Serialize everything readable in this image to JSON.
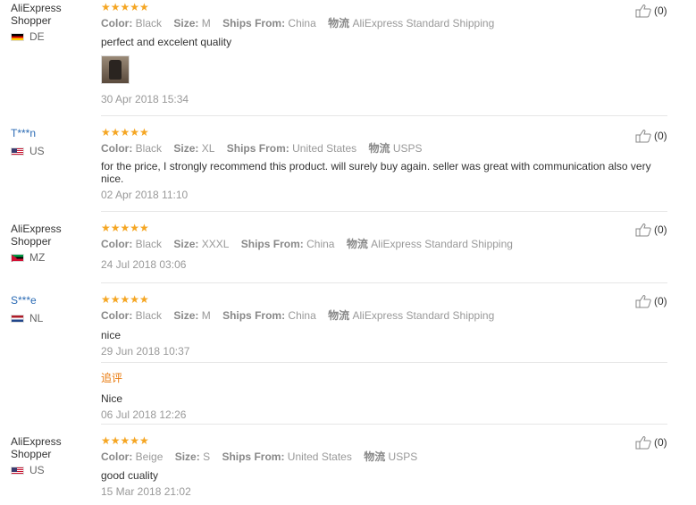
{
  "labels": {
    "color": "Color:",
    "size": "Size:",
    "ships": "Ships From:",
    "logistics": "物流"
  },
  "reviews": [
    {
      "user_line1": "AliExpress",
      "user_line2": "Shopper",
      "country": "DE",
      "stars": "★★★★★",
      "color": "Black",
      "size": "M",
      "ships": "China",
      "logistics": "AliExpress Standard Shipping",
      "text": "perfect and excelent quality",
      "date": "30 Apr 2018 15:34",
      "likes": "(0)"
    },
    {
      "user_line1": "T***n",
      "country": "US",
      "stars": "★★★★★",
      "color": "Black",
      "size": "XL",
      "ships": "United States",
      "logistics": "USPS",
      "text": "for the price, I strongly recommend this product. will surely buy again. seller was great with communication also very nice.",
      "date": "02 Apr 2018 11:10",
      "likes": "(0)"
    },
    {
      "user_line1": "AliExpress",
      "user_line2": "Shopper",
      "country": "MZ",
      "stars": "★★★★★",
      "color": "Black",
      "size": "XXXL",
      "ships": "China",
      "logistics": "AliExpress Standard Shipping",
      "date": "24 Jul 2018 03:06",
      "likes": "(0)"
    },
    {
      "user_line1": "S***e",
      "country": "NL",
      "stars": "★★★★★",
      "color": "Black",
      "size": "M",
      "ships": "China",
      "logistics": "AliExpress Standard Shipping",
      "text": "nice",
      "date": "29 Jun 2018 10:37",
      "likes": "(0)",
      "followup": {
        "label": "追评",
        "text": "Nice",
        "date": "06 Jul 2018 12:26"
      }
    },
    {
      "user_line1": "AliExpress",
      "user_line2": "Shopper",
      "country": "US",
      "stars": "★★★★★",
      "color": "Beige",
      "size": "S",
      "ships": "United States",
      "logistics": "USPS",
      "text": "good cuality",
      "date": "15 Mar 2018 21:02",
      "likes": "(0)"
    }
  ]
}
